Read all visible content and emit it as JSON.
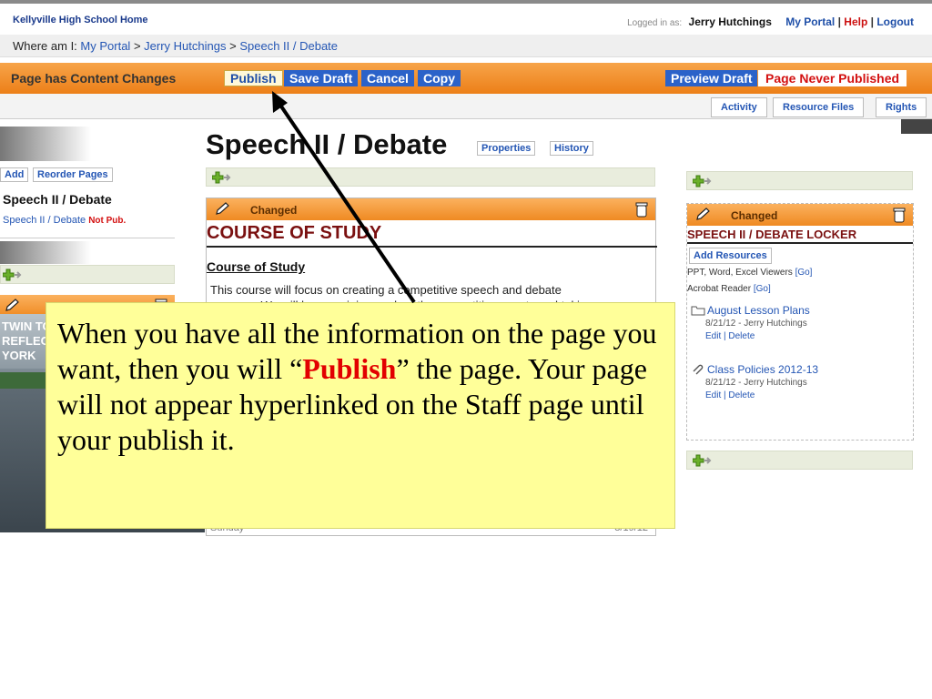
{
  "header": {
    "school_home": "Kellyville High School Home",
    "logged_in_label": "Logged in as:",
    "user": "Jerry Hutchings",
    "my_portal": "My Portal",
    "help": "Help",
    "logout": "Logout",
    "sep": "|"
  },
  "breadcrumb": {
    "label": "Where am I:",
    "items": [
      "My Portal",
      "Jerry Hutchings",
      "Speech II / Debate"
    ],
    "sep": ">"
  },
  "toolbar": {
    "status": "Page has Content Changes",
    "publish": "Publish",
    "save_draft": "Save Draft",
    "cancel": "Cancel",
    "copy": "Copy",
    "preview": "Preview Draft",
    "never_published": "Page Never Published"
  },
  "tabs": [
    "Activity",
    "Resource Files",
    "Rights"
  ],
  "page": {
    "title": "Speech II / Debate",
    "properties": "Properties",
    "history": "History"
  },
  "left": {
    "add": "Add",
    "reorder": "Reorder Pages",
    "section_title": "Speech II / Debate",
    "page_link": "Speech II / Debate",
    "not_pub": "Not Pub.",
    "photo_caption_lines": [
      "TWIN TO",
      "REFLEC",
      "YORK"
    ]
  },
  "center": {
    "changed": "Changed",
    "block_title": "COURSE OF STUDY",
    "subheading": "Course of Study",
    "body_line1": "This course will focus on creating a competitive speech and debate",
    "body_line2": "program.  We will be examining each of the competitive events and taking",
    "footer_left": "Sunday",
    "footer_right": "8/19/12"
  },
  "right": {
    "changed": "Changed",
    "block_title": "SPEECH II / DEBATE LOCKER",
    "add_resources": "Add Resources",
    "viewers1": "PPT, Word, Excel Viewers",
    "viewers2": "Acrobat Reader",
    "go": "[Go]",
    "items": [
      {
        "title": "August Lesson Plans",
        "meta": "8/21/12 - Jerry Hutchings",
        "actions": "Edit | Delete"
      },
      {
        "title": "Class Policies 2012-13",
        "meta": "8/21/12 - Jerry Hutchings",
        "actions": "Edit | Delete"
      }
    ]
  },
  "callout": {
    "part1": "When you have all the information on the page you want, then you will “",
    "publish": "Publish",
    "part2": "” the page.  Your page will not appear hyperlinked on the Staff page until your publish it."
  }
}
